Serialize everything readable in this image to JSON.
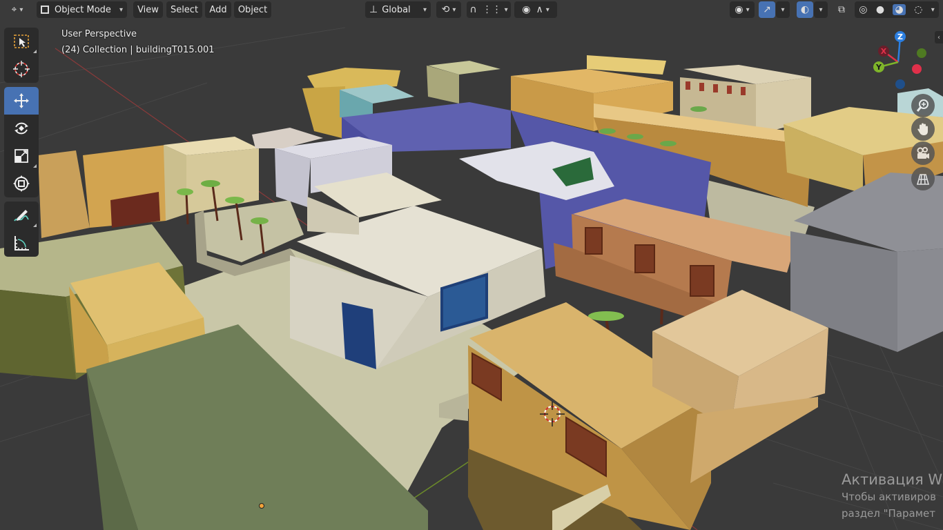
{
  "header": {
    "editor_type_icon": "3d-viewport-icon",
    "mode_label": "Object Mode",
    "menus": [
      "View",
      "Select",
      "Add",
      "Object"
    ],
    "transform_orientation": "Global"
  },
  "overlay": {
    "view_name": "User Perspective",
    "collection_info": "(24) Collection | buildingT015.001"
  },
  "toolbar": {
    "tools": [
      {
        "name": "select-box",
        "icon": "select-box-icon",
        "active": false
      },
      {
        "name": "cursor",
        "icon": "cursor-icon",
        "active": false
      },
      {
        "name": "move",
        "icon": "move-icon",
        "active": true
      },
      {
        "name": "rotate",
        "icon": "rotate-icon",
        "active": false
      },
      {
        "name": "scale",
        "icon": "scale-icon",
        "active": false
      },
      {
        "name": "transform",
        "icon": "transform-icon",
        "active": false
      },
      {
        "name": "annotate",
        "icon": "annotate-icon",
        "active": false
      },
      {
        "name": "measure",
        "icon": "measure-icon",
        "active": false
      }
    ]
  },
  "gizmo": {
    "axes": [
      {
        "label": "Z",
        "color": "#2c7fe0"
      },
      {
        "label": "X",
        "color": "#e0304a"
      },
      {
        "label": "Y",
        "color": "#7fb52a"
      }
    ]
  },
  "navigation": [
    "zoom-icon",
    "pan-hand-icon",
    "camera-icon",
    "ortho-grid-icon"
  ],
  "watermark": {
    "line1": "Активация W",
    "line2": "Чтобы активиров",
    "line3": "раздел \"Парамет"
  },
  "colors": {
    "ui_bg": "#2b2b2b",
    "accent": "#4772b3",
    "viewport_bg": "#3a3a3a"
  }
}
